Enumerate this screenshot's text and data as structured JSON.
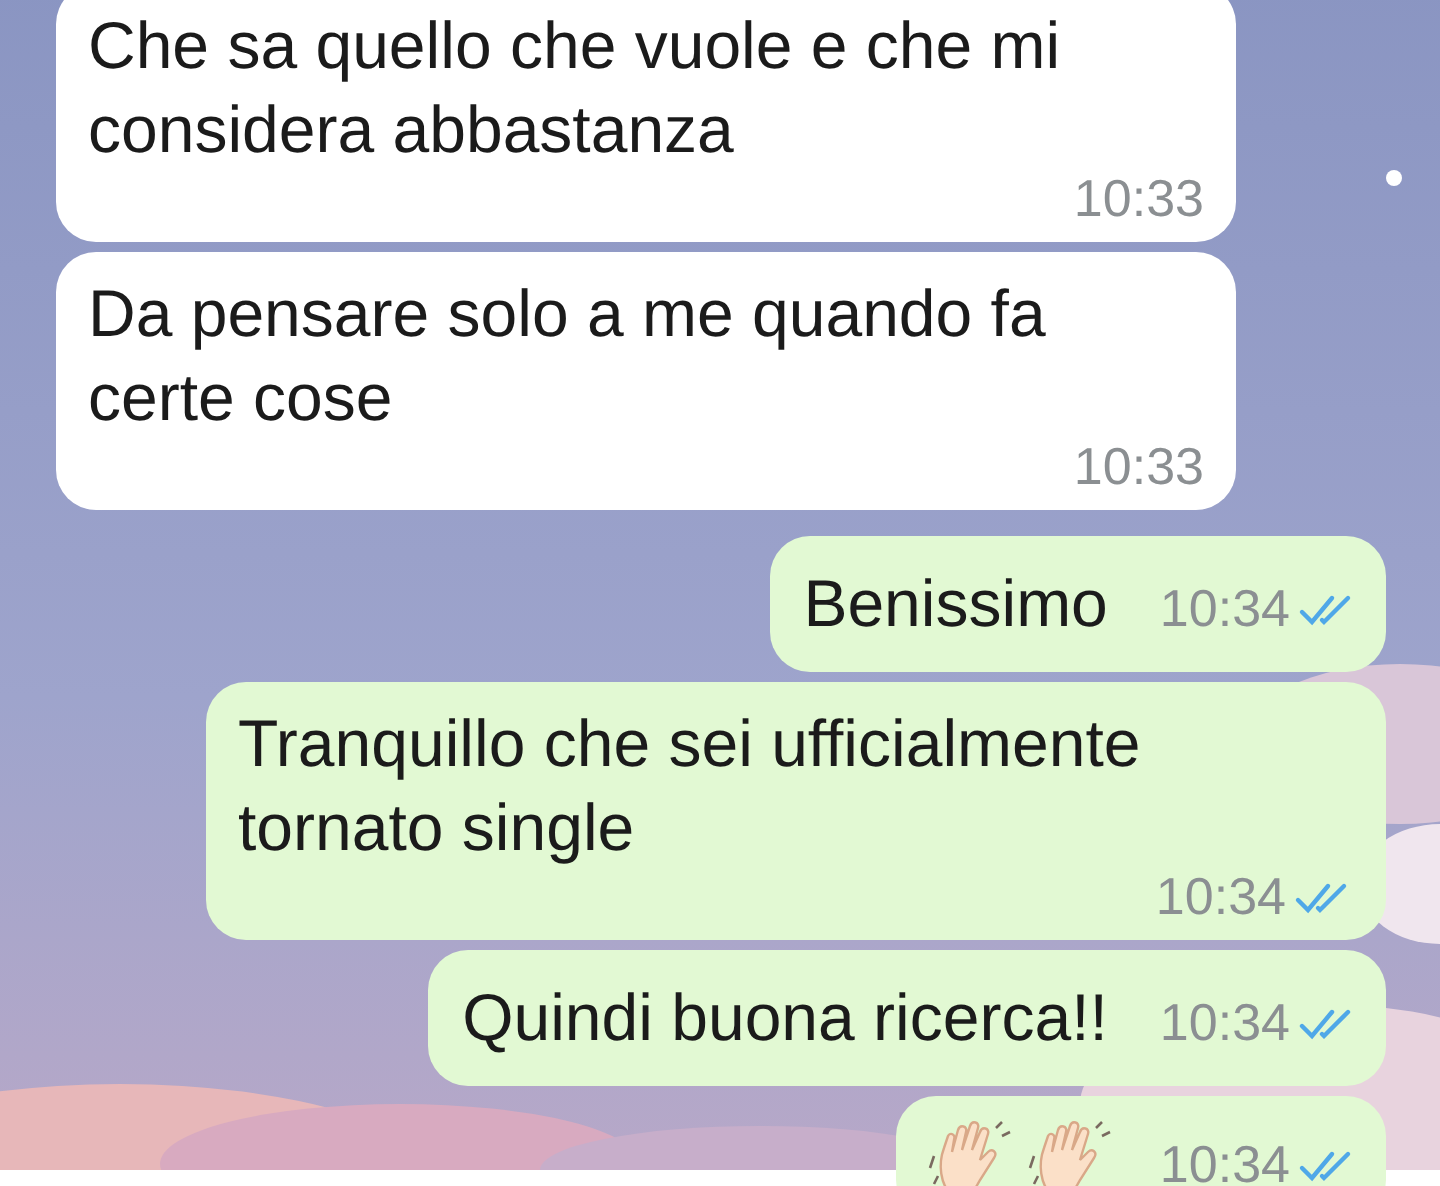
{
  "messages": [
    {
      "kind": "incoming",
      "text": "Che sa quello che vuole e che mi considera abbastanza",
      "time": "10:33"
    },
    {
      "kind": "incoming",
      "text": "Da pensare solo a me quando fa certe cose",
      "time": "10:33"
    },
    {
      "kind": "outgoing",
      "text": "Benissimo",
      "time": "10:34",
      "read": true
    },
    {
      "kind": "outgoing",
      "text": "Tranquillo che sei ufficialmente tornato single",
      "time": "10:34",
      "read": true
    },
    {
      "kind": "outgoing",
      "text": "Quindi buona ricerca!!",
      "time": "10:34",
      "read": true
    },
    {
      "kind": "outgoing_emoji",
      "time": "10:34",
      "read": true
    }
  ]
}
